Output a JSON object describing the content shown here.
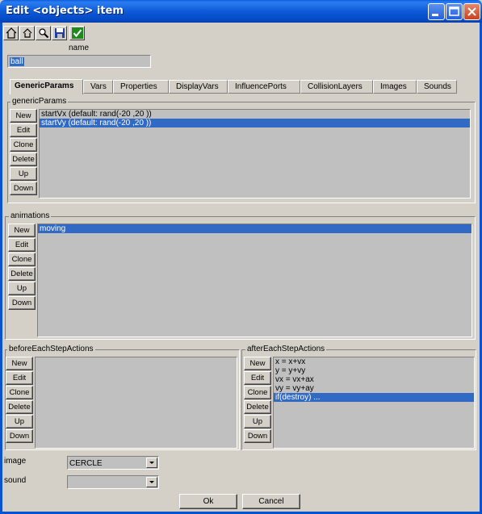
{
  "window": {
    "title": "Edit <objects> item"
  },
  "toolbar": {
    "icons": [
      "home-icon",
      "up-icon",
      "search-icon",
      "save-icon",
      "check-icon"
    ]
  },
  "name_field": {
    "label": "name",
    "value": "ball"
  },
  "tabs": [
    {
      "label": "GenericParams",
      "active": true
    },
    {
      "label": "Vars"
    },
    {
      "label": "Properties"
    },
    {
      "label": "DisplayVars"
    },
    {
      "label": "InfluencePorts"
    },
    {
      "label": "CollisionLayers"
    },
    {
      "label": "Images"
    },
    {
      "label": "Sounds"
    }
  ],
  "buttons": {
    "new": "New",
    "edit": "Edit",
    "clone": "Clone",
    "delete": "Delete",
    "up": "Up",
    "down": "Down"
  },
  "genericParams": {
    "title": "genericParams",
    "items": [
      "startVx (default: rand(-20 ,20 ))",
      "startVy (default: rand(-20 ,20 ))"
    ],
    "selected_index": 1
  },
  "animations": {
    "title": "animations",
    "items": [
      "moving"
    ],
    "selected_index": 0
  },
  "beforeEachStepActions": {
    "title": "beforeEachStepActions",
    "items": []
  },
  "afterEachStepActions": {
    "title": "afterEachStepActions",
    "items": [
      "x = x+vx",
      "y = y+vy",
      "vx = vx+ax",
      "vy = vy+ay",
      "if(destroy) ..."
    ],
    "selected_index": 4
  },
  "image": {
    "label": "image",
    "value": "CERCLE"
  },
  "sound": {
    "label": "sound",
    "value": ""
  },
  "dialog": {
    "ok": "Ok",
    "cancel": "Cancel"
  },
  "colors": {
    "titlebar": "#0a5fe0",
    "selection": "#316ac5",
    "face": "#d4d0c8",
    "list_bg": "#c0c0c0"
  }
}
